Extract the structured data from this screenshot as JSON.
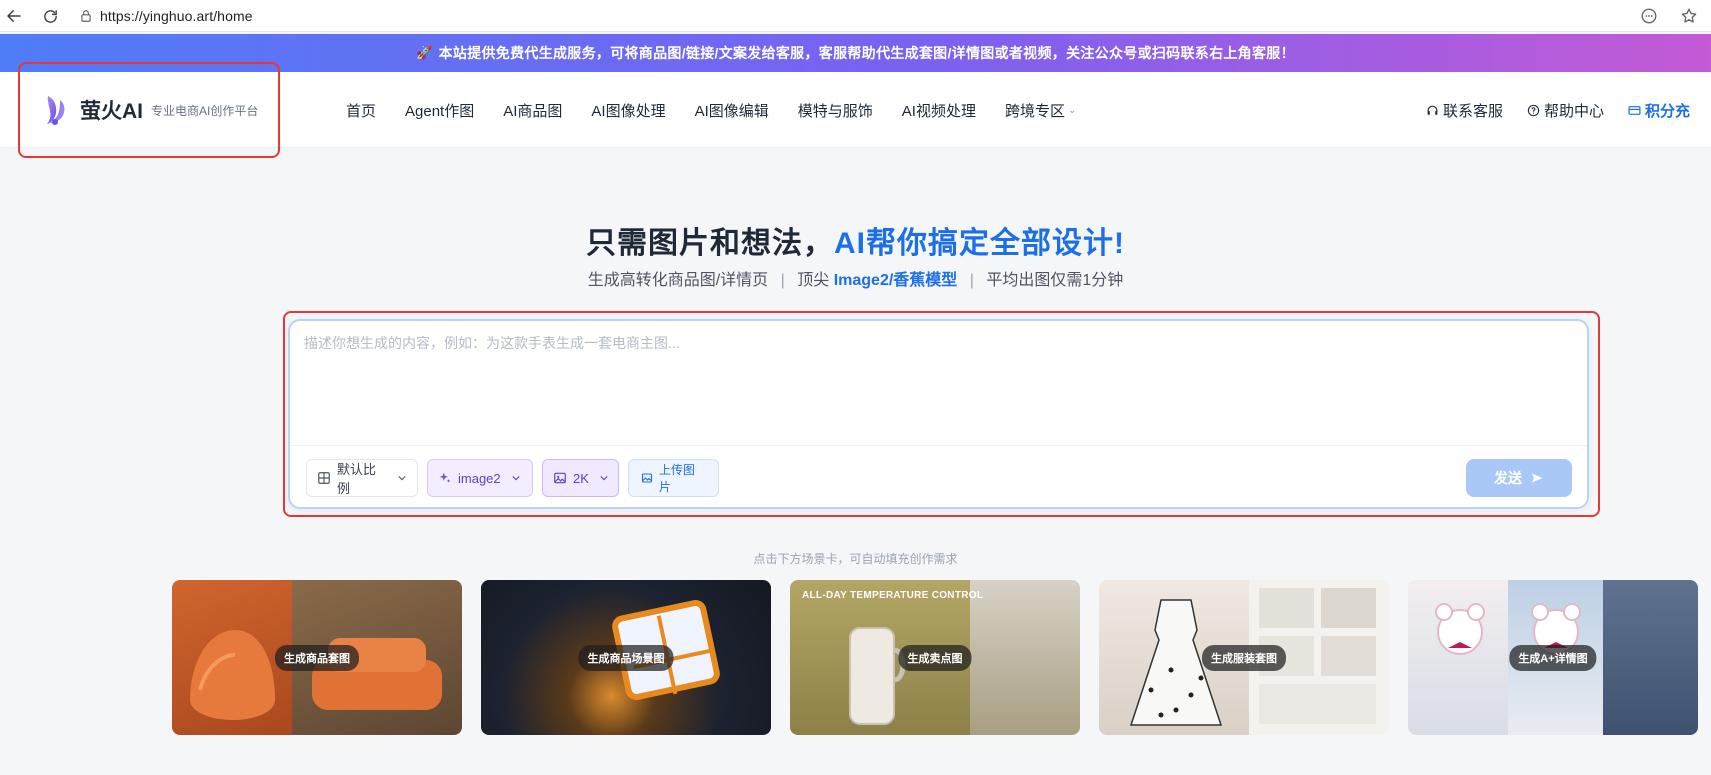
{
  "browser": {
    "url": "https://yinghuo.art/home"
  },
  "banner": {
    "text": "本站提供免费代生成服务，可将商品图/链接/文案发给客服，客服帮助代生成套图/详情图或者视频，关注公众号或扫码联系右上角客服！"
  },
  "brand": {
    "name": "萤火AI",
    "subtitle": "专业电商AI创作平台"
  },
  "nav": {
    "items": [
      {
        "label": "首页"
      },
      {
        "label": "Agent作图"
      },
      {
        "label": "AI商品图"
      },
      {
        "label": "AI图像处理"
      },
      {
        "label": "AI图像编辑"
      },
      {
        "label": "模特与服饰"
      },
      {
        "label": "AI视频处理"
      },
      {
        "label": "跨境专区"
      }
    ]
  },
  "header_right": {
    "support": "联系客服",
    "help": "帮助中心",
    "points": "积分充"
  },
  "hero": {
    "title_main": "只需图片和想法，",
    "title_accent": "AI帮你搞定全部设计!",
    "sub_1": "生成高转化商品图/详情页",
    "sub_sep": "|",
    "sub_2_prefix": "顶尖",
    "sub_2_highlight": "Image2/香蕉模型",
    "sub_3": "平均出图仅需1分钟"
  },
  "composer": {
    "placeholder": "描述你想生成的内容，例如：为这款手表生成一套电商主图...",
    "value": "",
    "ratio_label": "默认比例",
    "model_label": "image2",
    "resolution_label": "2K",
    "upload_label": "上传图片",
    "send_label": "发送"
  },
  "scenes": {
    "hint": "点击下方场景卡，可自动填充创作需求",
    "cards": [
      {
        "label": "生成商品套图",
        "colors": [
          "#c8592a",
          "#7a5b3f"
        ]
      },
      {
        "label": "生成商品场景图",
        "colors": [
          "#1c2230",
          "#3a3326"
        ]
      },
      {
        "label": "生成卖点图",
        "tagline": "ALL-DAY TEMPERATURE CONTROL",
        "colors": [
          "#a69a5c",
          "#8a7f4a"
        ]
      },
      {
        "label": "生成服装套图",
        "colors": [
          "#ebe6e0",
          "#d9d4ce"
        ]
      },
      {
        "label": "生成A+详情图",
        "colors": [
          "#d9dee6",
          "#5f7390"
        ]
      }
    ]
  },
  "colors": {
    "accent": "#1d6fe8",
    "highlight_box": "#e53935",
    "banner_start": "#4f7cf7",
    "banner_end": "#c35ad6"
  }
}
